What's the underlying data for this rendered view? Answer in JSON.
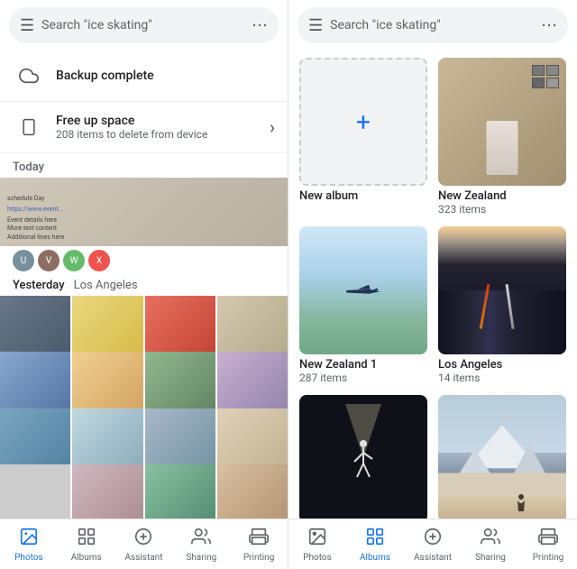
{
  "left": {
    "search": {
      "placeholder": "Search \"ice skating\"",
      "more_icon": "⋯"
    },
    "notifications": [
      {
        "id": "backup",
        "icon": "cloud",
        "title": "Backup complete",
        "sub": ""
      },
      {
        "id": "free-space",
        "icon": "phone",
        "title": "Free up space",
        "sub": "208 items to delete from device",
        "has_arrow": true
      }
    ],
    "sections": [
      {
        "label": "Today",
        "type": "today"
      },
      {
        "label": "Yesterday",
        "place": "Los Angeles",
        "type": "grid"
      }
    ],
    "nav": [
      {
        "id": "photos",
        "label": "Photos",
        "icon": "🖼",
        "active": true
      },
      {
        "id": "albums",
        "label": "Albums",
        "icon": "📁",
        "active": false
      },
      {
        "id": "assistant",
        "label": "Assistant",
        "icon": "➕",
        "active": false
      },
      {
        "id": "sharing",
        "label": "Sharing",
        "icon": "👤",
        "active": false
      },
      {
        "id": "printing",
        "label": "Printing",
        "icon": "📖",
        "active": false
      }
    ]
  },
  "right": {
    "search": {
      "placeholder": "Search \"ice skating\"",
      "more_icon": "⋯"
    },
    "albums": [
      {
        "id": "new-album",
        "title": "New album",
        "count": "",
        "type": "new"
      },
      {
        "id": "new-zealand",
        "title": "New Zealand",
        "count": "323 items",
        "type": "photo"
      },
      {
        "id": "new-zealand-1",
        "title": "New Zealand 1",
        "count": "287 items",
        "type": "photo"
      },
      {
        "id": "los-angeles",
        "title": "Los Angeles",
        "count": "14 items",
        "type": "photo"
      },
      {
        "id": "performance",
        "title": "",
        "count": "",
        "type": "photo"
      },
      {
        "id": "mountain",
        "title": "",
        "count": "",
        "type": "photo"
      }
    ],
    "nav": [
      {
        "id": "photos",
        "label": "Photos",
        "icon": "🖼",
        "active": false
      },
      {
        "id": "albums",
        "label": "Albums",
        "icon": "📁",
        "active": true
      },
      {
        "id": "assistant",
        "label": "Assistant",
        "icon": "➕",
        "active": false
      },
      {
        "id": "sharing",
        "label": "Sharing",
        "icon": "👤",
        "active": false
      },
      {
        "id": "printing",
        "label": "Printing",
        "icon": "📖",
        "active": false
      }
    ]
  }
}
